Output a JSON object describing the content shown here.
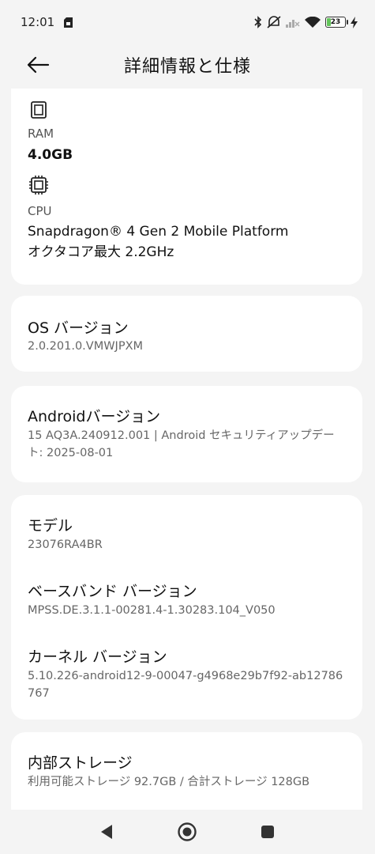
{
  "status": {
    "time": "12:01",
    "battery": "23",
    "battery_level": 0.23,
    "icons": [
      "sim-card-icon",
      "bluetooth-icon",
      "mute-icon",
      "signal-icon",
      "wifi-icon",
      "battery-icon",
      "charging-icon"
    ]
  },
  "header": {
    "title": "詳細情報と仕様",
    "back_icon": "arrow-left-icon"
  },
  "specs": {
    "ram_label": "RAM",
    "ram_value": "4.0GB",
    "cpu_label": "CPU",
    "cpu_value_line1": "Snapdragon® 4 Gen 2 Mobile Platform",
    "cpu_value_line2": "オクタコア最大 2.2GHz"
  },
  "rows": {
    "os_title": "OS バージョン",
    "os_value": "2.0.201.0.VMWJPXM",
    "android_title": "Androidバージョン",
    "android_value": "15 AQ3A.240912.001 | Android セキュリティアップデート: 2025-08-01",
    "model_title": "モデル",
    "model_value": "23076RA4BR",
    "baseband_title": "ベースバンド バージョン",
    "baseband_value": "MPSS.DE.3.1.1-00281.4-1.30283.104_V050",
    "kernel_title": "カーネル バージョン",
    "kernel_value": "5.10.226-android12-9-00047-g4968e29b7f92-ab12786767",
    "storage_title": "内部ストレージ",
    "storage_value": "利用可能ストレージ  92.7GB / 合計ストレージ 128GB"
  },
  "colors": {
    "background": "#f4f4f4",
    "card": "#ffffff",
    "battery_fill": "#63c55a"
  }
}
